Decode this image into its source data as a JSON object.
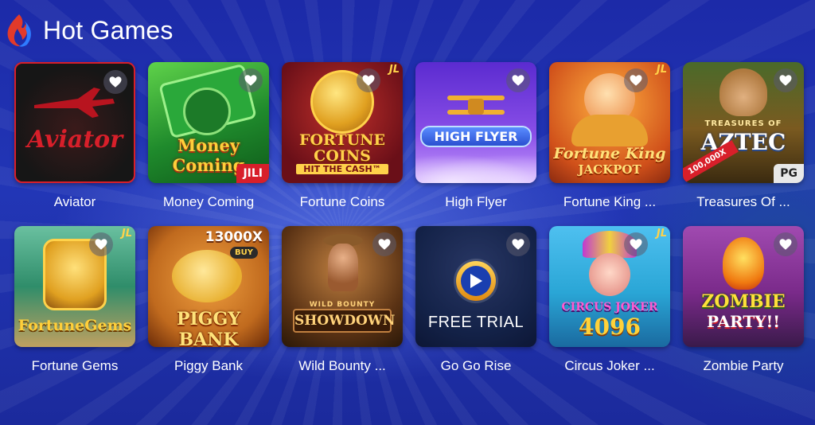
{
  "header": {
    "title": "Hot Games",
    "icon": "flame-icon"
  },
  "colors": {
    "background": "#2236b6",
    "accent_flame_red": "#e23a2a",
    "accent_flame_blue": "#2f7bff",
    "free_trial_button": "#f0a020"
  },
  "games": [
    {
      "name": "Aviator",
      "art_title": "Aviator",
      "art_bg": "#1d1d1f",
      "art_color": "#d81f2a"
    },
    {
      "name": "Money Coming",
      "art_title": "Money Coming",
      "badge": "JILI",
      "art_bg": "#1f8a2c",
      "art_color": "#ffcf3a"
    },
    {
      "name": "Fortune Coins",
      "art_title": "FORTUNE COINS",
      "art_subtitle": "HIT THE CASH™",
      "badge": "JL",
      "art_bg": "#7a1420",
      "art_color": "#ffd24a"
    },
    {
      "name": "High Flyer",
      "art_title": "HIGH FLYER",
      "art_bg": "#7a3fd6",
      "art_color": "#ffffff"
    },
    {
      "name": "Fortune King ...",
      "art_title": "Fortune King",
      "art_subtitle": "JACKPOT",
      "badge": "JL",
      "art_bg": "#d0501a",
      "art_color": "#ffe27a"
    },
    {
      "name": "Treasures Of ...",
      "art_title": "AZTEC",
      "art_subtitle": "TREASURES OF",
      "badge": "PG",
      "ribbon": "100,000X",
      "art_bg": "#3a5f2a",
      "art_color": "#ffffff"
    },
    {
      "name": "Fortune Gems",
      "art_title": "FortuneGems",
      "badge": "JL",
      "art_bg": "#2f8d6a",
      "art_color": "#ffcf3a"
    },
    {
      "name": "Piggy Bank",
      "art_title": "PIGGY BANK",
      "art_subtitle": "13000X",
      "badge": "BUY",
      "art_bg": "#c06a1e",
      "art_color": "#ffe37a"
    },
    {
      "name": "Wild Bounty ...",
      "art_title": "SHOWDOWN",
      "art_subtitle": "WILD BOUNTY",
      "art_bg": "#5a3214",
      "art_color": "#ffd27a"
    },
    {
      "name": "Go Go Rise",
      "free_trial_label": "FREE TRIAL",
      "art_bg": "#1a2a55",
      "art_color": "#ffffff"
    },
    {
      "name": "Circus Joker ...",
      "art_title": "CIRCUS JOKER",
      "art_subtitle": "4096",
      "badge": "JL",
      "art_bg": "#2aa6d6",
      "art_color": "#ffd23a"
    },
    {
      "name": "Zombie Party",
      "art_title": "ZOMBIE",
      "art_subtitle": "PARTY!!",
      "art_bg": "#7a2a8a",
      "art_color": "#ffe03a"
    }
  ]
}
